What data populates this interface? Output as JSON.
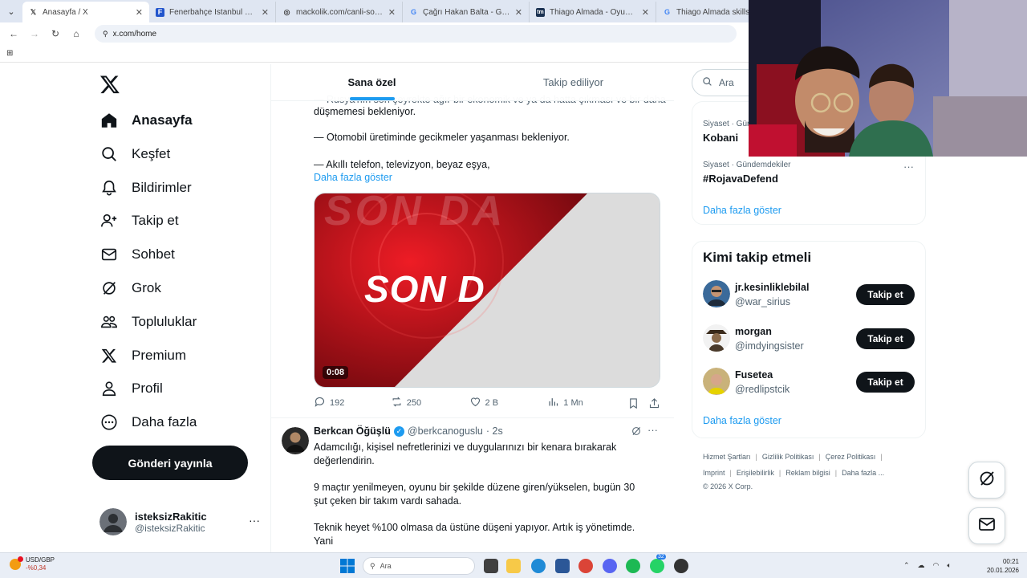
{
  "browser": {
    "tabs": [
      {
        "title": "Anasayfa / X",
        "favicon": "x-logo-icon",
        "active": true
      },
      {
        "title": "Fenerbahçe İstanbul canlı skoru",
        "favicon": "sports-icon",
        "active": false
      },
      {
        "title": "mackolik.com/canli-sonuclar",
        "favicon": "globe-icon",
        "active": false
      },
      {
        "title": "Çağrı Hakan Balta - Google'da Ara",
        "favicon": "google-icon",
        "active": false
      },
      {
        "title": "Thiago Almada - Oyuncu profili",
        "favicon": "transfermarkt-icon",
        "active": false
      },
      {
        "title": "Thiago Almada skills - Google'da Ara",
        "favicon": "google-icon",
        "active": false
      }
    ],
    "url": "x.com/home"
  },
  "sidebar": {
    "items": [
      {
        "label": "Anasayfa",
        "icon": "home-icon"
      },
      {
        "label": "Keşfet",
        "icon": "search-icon"
      },
      {
        "label": "Bildirimler",
        "icon": "bell-icon"
      },
      {
        "label": "Takip et",
        "icon": "person-add-icon"
      },
      {
        "label": "Sohbet",
        "icon": "mail-icon"
      },
      {
        "label": "Grok",
        "icon": "grok-icon"
      },
      {
        "label": "Topluluklar",
        "icon": "communities-icon"
      },
      {
        "label": "Premium",
        "icon": "x-logo-icon"
      },
      {
        "label": "Profil",
        "icon": "person-icon"
      },
      {
        "label": "Daha fazla",
        "icon": "more-circle-icon"
      }
    ],
    "post_button": "Gönderi yayınla",
    "account": {
      "name": "isteksizRakitic",
      "handle": "@isteksizRakitic"
    }
  },
  "feed": {
    "tabs": [
      "Sana özel",
      "Takip ediliyor"
    ],
    "tweet1": {
      "text_lines": [
        "— Rusya'nın son çeyrekte ağır bir ekonomik ve ya da hatta çıkması ve bir daha",
        "düşmemesi bekleniyor.",
        "— Otomobil üretiminde gecikmeler yaşanması bekleniyor.",
        "— Akıllı telefon, televizyon, beyaz eşya,"
      ],
      "show_more": "Daha fazla göster",
      "video_text": "SON D",
      "video_bg_text": "SON DA",
      "duration": "0:08",
      "stats": {
        "replies": "192",
        "reposts": "250",
        "likes": "2 B",
        "views": "1 Mn"
      }
    },
    "tweet2": {
      "name": "Berkcan Öğüşlü",
      "handle": "@berkcanoguslu",
      "time": "· 2s",
      "paragraphs": [
        "Adamcılığı, kişisel nefretlerinizi ve duygularınızı bir kenara bırakarak",
        "değerlendirin.",
        "9 maçtır yenilmeyen, oyunu bir şekilde düzene giren/yükselen, bugün 30",
        "şut çeken bir takım vardı sahada.",
        "Teknik heyet %100 olmasa da üstüne düşeni yapıyor. Artık iş yönetimde.",
        "Yani"
      ]
    }
  },
  "right": {
    "search_placeholder": "Ara",
    "trends": [
      {
        "category": "Siyaset · Gündemdekiler",
        "name": "Kobani"
      },
      {
        "category": "Siyaset · Gündemdekiler",
        "name": "#RojavaDefend"
      }
    ],
    "trends_more": "Daha fazla göster",
    "who_to_follow": {
      "title": "Kimi takip etmeli",
      "users": [
        {
          "name": "jr.kesinliklebilal",
          "handle": "@war_sirius",
          "button": "Takip et"
        },
        {
          "name": "morgan",
          "handle": "@imdyingsister",
          "button": "Takip et"
        },
        {
          "name": "Fusetea",
          "handle": "@redlipstcik",
          "button": "Takip et"
        }
      ],
      "more": "Daha fazla göster"
    },
    "footer_row1": [
      "Hizmet Şartları",
      "Gizlilik Politikası",
      "Çerez Politikası"
    ],
    "footer_row2": [
      "Imprint",
      "Erişilebilirlik",
      "Reklam bilgisi",
      "Daha fazla ..."
    ],
    "copyright": "© 2026 X Corp."
  },
  "taskbar": {
    "ticker_name": "USD/GBP",
    "ticker_change": "-%0,34",
    "search": "Ara",
    "time": "00:21",
    "date": "20.01.2026",
    "badge": "32"
  },
  "colors": {
    "accent": "#1d9bf0",
    "text": "#0f1419",
    "muted": "#536471",
    "video_red": "#c4101a"
  }
}
